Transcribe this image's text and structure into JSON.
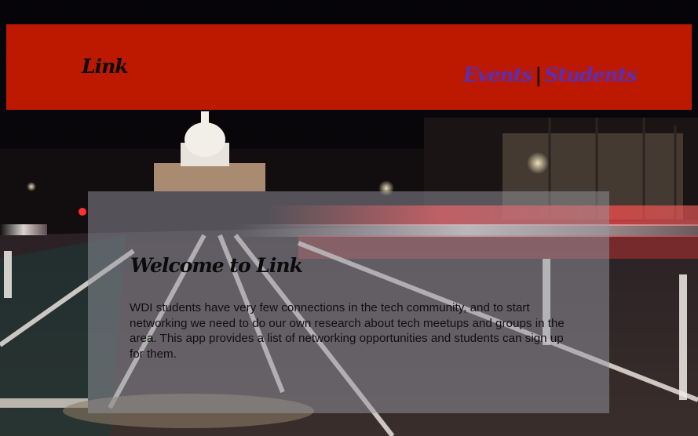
{
  "header": {
    "brand": "Link",
    "nav": {
      "events_label": "Events",
      "separator": "|",
      "students_label": "Students"
    }
  },
  "welcome": {
    "title": "Welcome to Link",
    "body": "WDI students have very few connections in the tech community, and to start networking we need to do our own research about tech meetups and groups in the area. This app provides a list of networking opportunities and students can sign up for them."
  },
  "colors": {
    "header_bg": "#bd1800",
    "nav_link": "#5a2fb6",
    "brand_text": "#0b0b0b",
    "panel_overlay": "rgba(150,152,162,0.5)"
  }
}
